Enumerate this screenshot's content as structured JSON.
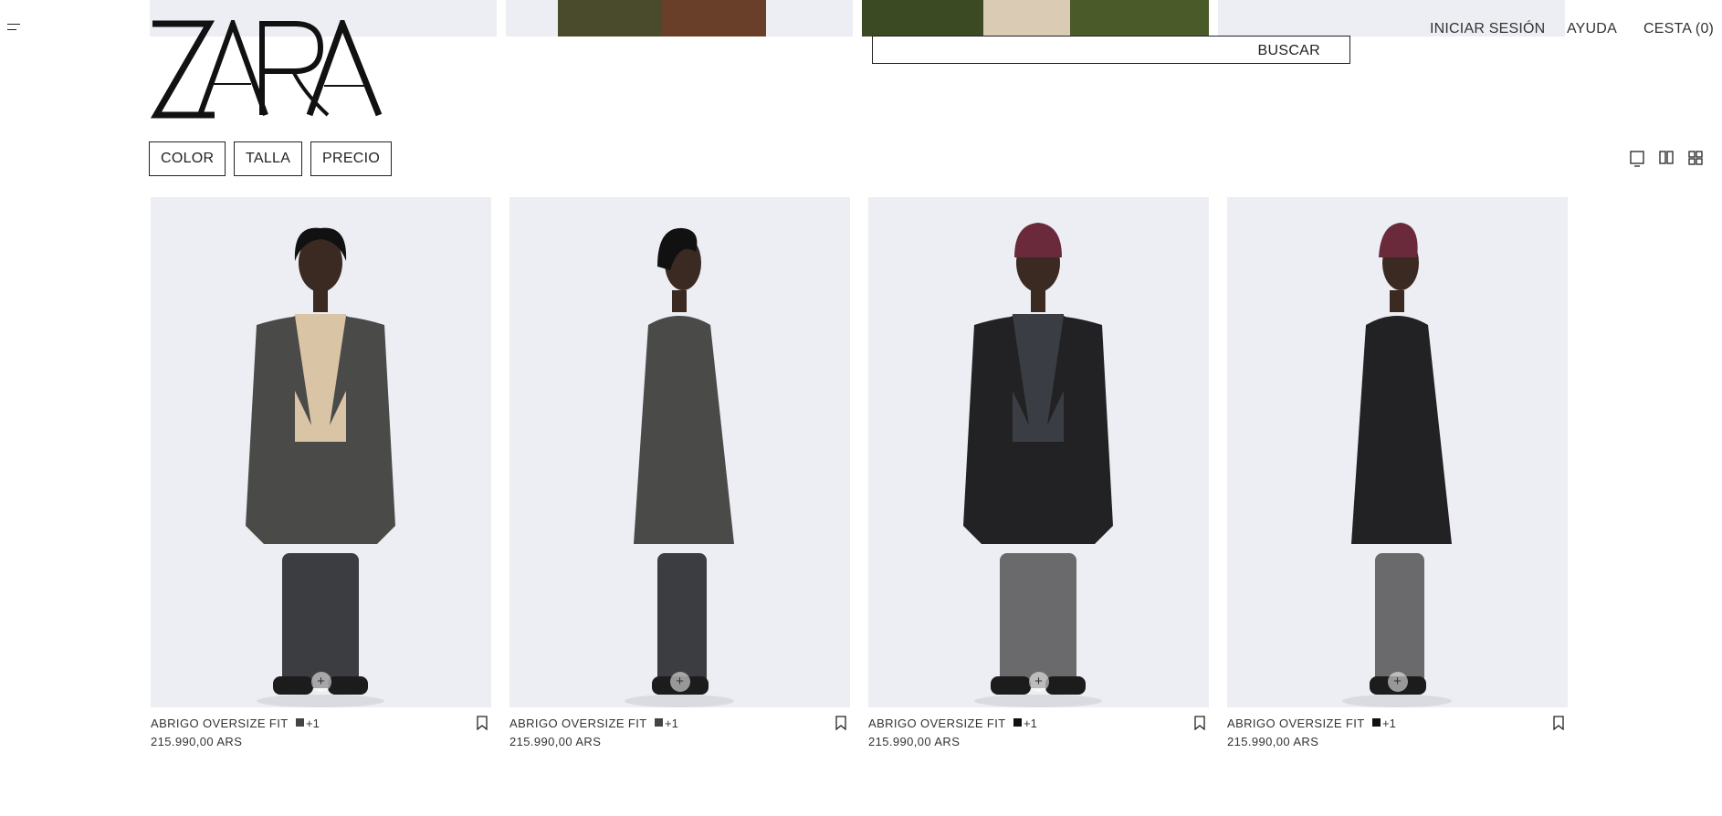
{
  "header": {
    "brand": "ZARA",
    "search_label": "BUSCAR",
    "links": {
      "login": "INICIAR SESIÓN",
      "help": "AYUDA",
      "cart": "CESTA (0)"
    }
  },
  "filters": [
    "COLOR",
    "TALLA",
    "PRECIO"
  ],
  "view_icons": [
    "single-view-icon",
    "two-column-view-icon",
    "grid-view-icon"
  ],
  "products": [
    {
      "name": "ABRIGO OVERSIZE FIT",
      "colors_more": "+1",
      "price": "215.990,00 ARS",
      "swatch": "#444444",
      "figure": {
        "coat": "#4a4a48",
        "inner": "#d9c4a6",
        "pants": "#3c3d40",
        "hat": null,
        "profile": false
      }
    },
    {
      "name": "ABRIGO OVERSIZE FIT",
      "colors_more": "+1",
      "price": "215.990,00 ARS",
      "swatch": "#444444",
      "figure": {
        "coat": "#4a4a48",
        "inner": "#d9c4a6",
        "pants": "#3c3d40",
        "hat": null,
        "profile": true
      }
    },
    {
      "name": "ABRIGO OVERSIZE FIT",
      "colors_more": "+1",
      "price": "215.990,00 ARS",
      "swatch": "#111111",
      "figure": {
        "coat": "#222225",
        "inner": "#3a3d44",
        "pants": "#6a6a6c",
        "hat": "#6a2a3c",
        "profile": false
      }
    },
    {
      "name": "ABRIGO OVERSIZE FIT",
      "colors_more": "+1",
      "price": "215.990,00 ARS",
      "swatch": "#111111",
      "figure": {
        "coat": "#222225",
        "inner": "#3a3d44",
        "pants": "#6a6a6c",
        "hat": "#6a2a3c",
        "profile": true
      }
    }
  ],
  "colors": {
    "background": "#ffffff",
    "text": "#222222",
    "image_bg": "#eceef3"
  }
}
